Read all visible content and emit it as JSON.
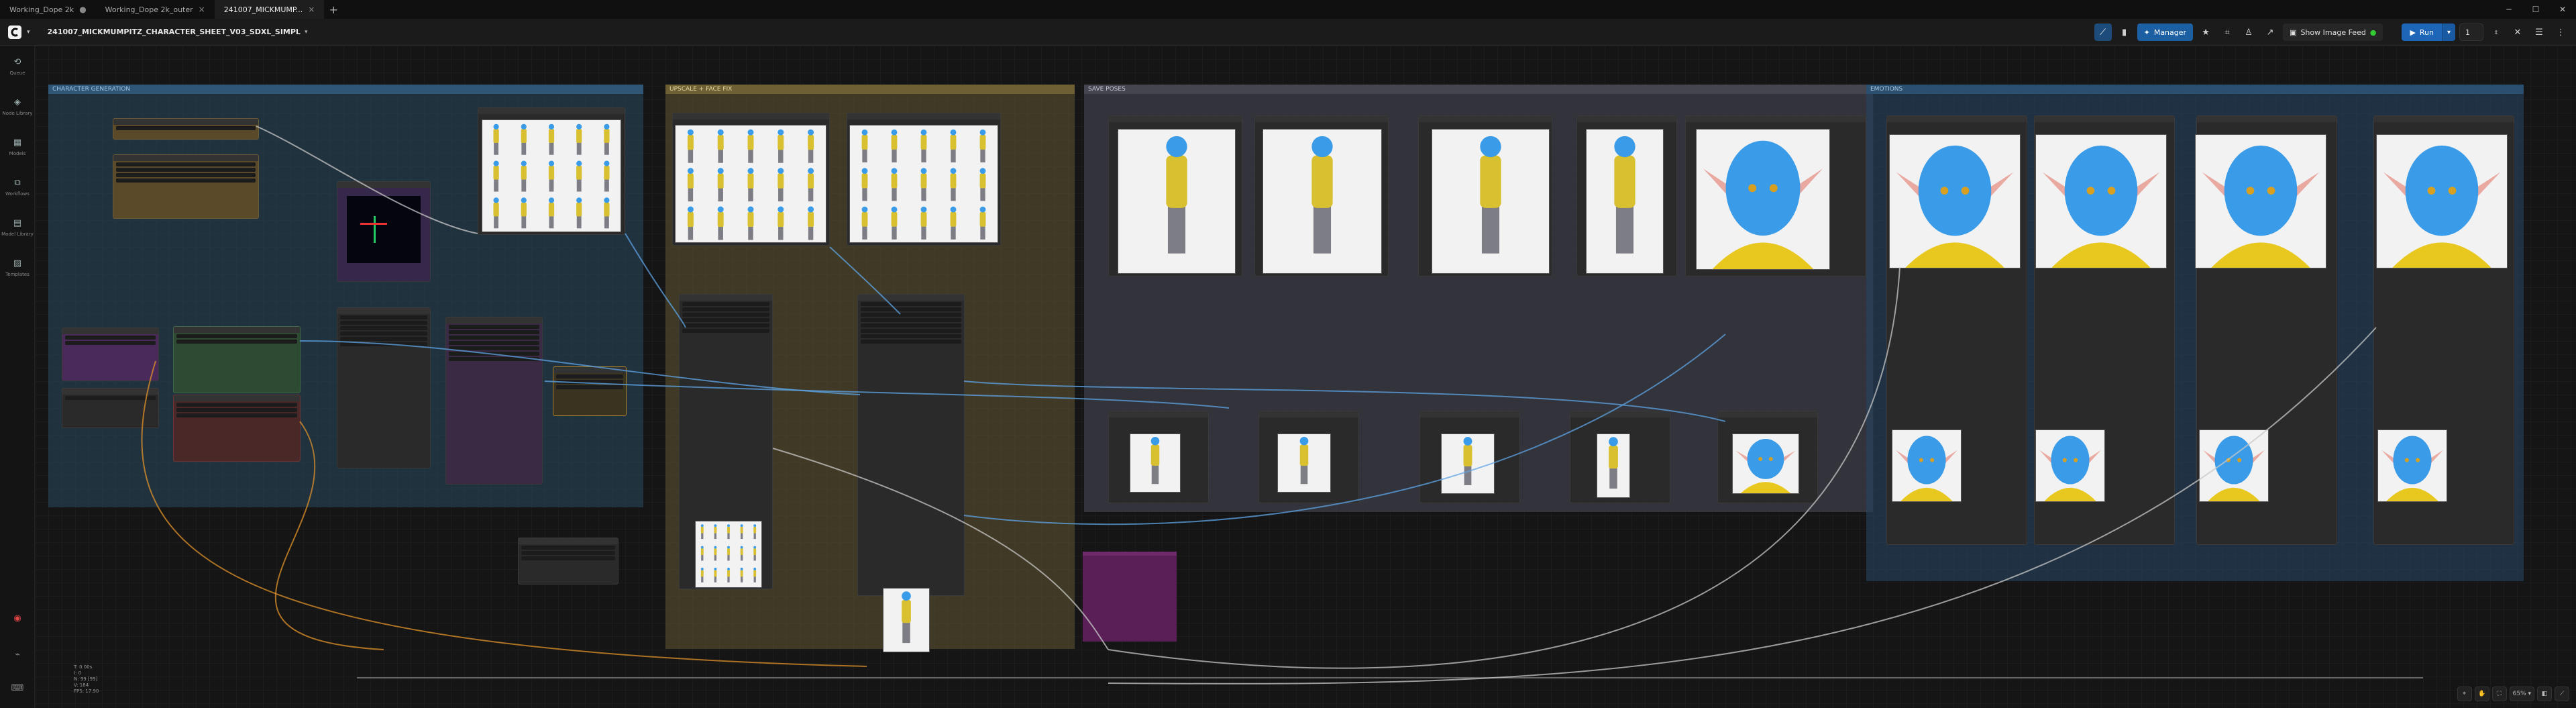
{
  "tabs": [
    {
      "label": "Working_Dope 2k",
      "active": false
    },
    {
      "label": "Working_Dope 2k_outer",
      "active": false
    },
    {
      "label": "241007_MICKMUMP...",
      "active": true
    }
  ],
  "toolbar": {
    "workflow_title": "241007_MICKMUMPITZ_CHARACTER_SHEET_V03_SDXL_SIMPL",
    "manager_label": "Manager",
    "image_feed_label": "Show Image Feed",
    "run_label": "Run",
    "run_count": "1"
  },
  "sidebar": {
    "items": [
      {
        "label": "Queue",
        "icon": "history-icon"
      },
      {
        "label": "Node Library",
        "icon": "cube-icon"
      },
      {
        "label": "Models",
        "icon": "box-icon"
      },
      {
        "label": "Workflows",
        "icon": "sitemap-icon"
      },
      {
        "label": "Model Library",
        "icon": "books-icon"
      },
      {
        "label": "Templates",
        "icon": "images-icon"
      }
    ]
  },
  "groups": [
    {
      "key": "character",
      "title": "CHARACTER GENERATION"
    },
    {
      "key": "upscale",
      "title": "UPSCALE + FACE FIX"
    },
    {
      "key": "save",
      "title": "SAVE POSES"
    },
    {
      "key": "emotions",
      "title": "EMOTIONS"
    }
  ],
  "debug": {
    "lines": [
      "T: 0.00s",
      "I: 0",
      "N: 99 [99]",
      "V: 184",
      "FPS: 17.90"
    ]
  },
  "canvas_controls": {
    "zoom": "65%"
  },
  "colors": {
    "character_group": "#2b4a63",
    "upscale_group": "#5e5230",
    "save_group": "#3b3b45",
    "emotions_group": "#274560",
    "accent": "#1d66b8",
    "wire_blue": "#5da4e6",
    "wire_orange": "#e0922a",
    "wire_white": "#c8c8c8"
  }
}
